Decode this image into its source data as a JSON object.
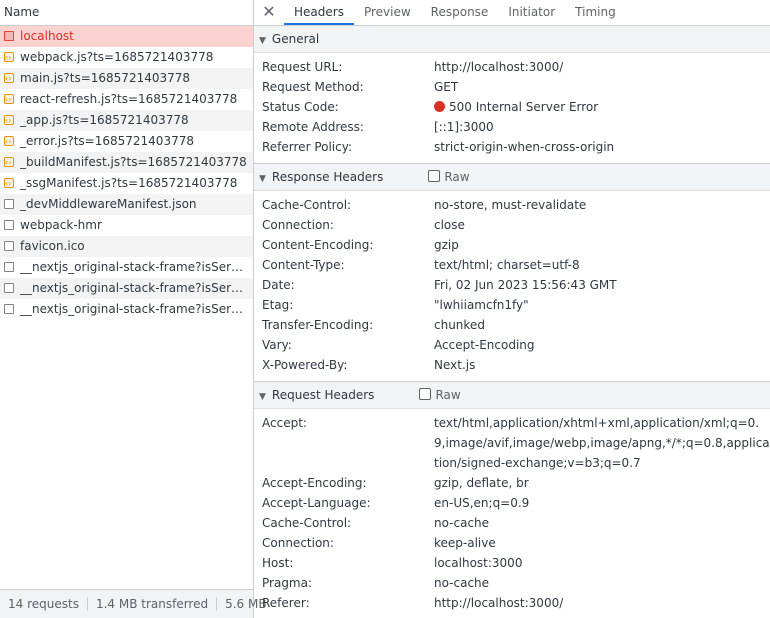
{
  "network": {
    "column_header": "Name",
    "requests": [
      {
        "name": "localhost",
        "icon": "document-icon",
        "selected": true
      },
      {
        "name": "webpack.js?ts=1685721403778",
        "icon": "script-icon"
      },
      {
        "name": "main.js?ts=1685721403778",
        "icon": "script-icon"
      },
      {
        "name": "react-refresh.js?ts=1685721403778",
        "icon": "script-icon"
      },
      {
        "name": "_app.js?ts=1685721403778",
        "icon": "script-icon"
      },
      {
        "name": "_error.js?ts=1685721403778",
        "icon": "script-icon"
      },
      {
        "name": "_buildManifest.js?ts=1685721403778",
        "icon": "script-icon"
      },
      {
        "name": "_ssgManifest.js?ts=1685721403778",
        "icon": "script-icon"
      },
      {
        "name": "_devMiddlewareManifest.json",
        "icon": "document-icon"
      },
      {
        "name": "webpack-hmr",
        "icon": "document-icon"
      },
      {
        "name": "favicon.ico",
        "icon": "document-icon"
      },
      {
        "name": "__nextjs_original-stack-frame?isServer=...",
        "icon": "document-icon"
      },
      {
        "name": "__nextjs_original-stack-frame?isServer=...",
        "icon": "document-icon"
      },
      {
        "name": "__nextjs_original-stack-frame?isServer=...",
        "icon": "document-icon"
      }
    ],
    "status": {
      "requests": "14 requests",
      "transferred": "1.4 MB transferred",
      "resources": "5.6 MB"
    }
  },
  "details": {
    "close": "✕",
    "tabs": [
      "Headers",
      "Preview",
      "Response",
      "Initiator",
      "Timing"
    ],
    "active_tab": "Headers",
    "general": {
      "title": "General",
      "rows": [
        {
          "key": "Request URL:",
          "value": "http://localhost:3000/"
        },
        {
          "key": "Request Method:",
          "value": "GET"
        },
        {
          "key": "Status Code:",
          "value": "500 Internal Server Error",
          "status_dot": "#d93025"
        },
        {
          "key": "Remote Address:",
          "value": "[::1]:3000"
        },
        {
          "key": "Referrer Policy:",
          "value": "strict-origin-when-cross-origin"
        }
      ]
    },
    "response_headers": {
      "title": "Response Headers",
      "raw_label": "Raw",
      "rows": [
        {
          "key": "Cache-Control:",
          "value": "no-store, must-revalidate"
        },
        {
          "key": "Connection:",
          "value": "close"
        },
        {
          "key": "Content-Encoding:",
          "value": "gzip"
        },
        {
          "key": "Content-Type:",
          "value": "text/html; charset=utf-8"
        },
        {
          "key": "Date:",
          "value": "Fri, 02 Jun 2023 15:56:43 GMT"
        },
        {
          "key": "Etag:",
          "value": "\"lwhiiamcfn1fy\""
        },
        {
          "key": "Transfer-Encoding:",
          "value": "chunked"
        },
        {
          "key": "Vary:",
          "value": "Accept-Encoding"
        },
        {
          "key": "X-Powered-By:",
          "value": "Next.js"
        }
      ]
    },
    "request_headers": {
      "title": "Request Headers",
      "raw_label": "Raw",
      "rows": [
        {
          "key": "Accept:",
          "value": "text/html,application/xhtml+xml,application/xml;q=0.9,image/avif,image/webp,image/apng,*/*;q=0.8,application/signed-exchange;v=b3;q=0.7"
        },
        {
          "key": "Accept-Encoding:",
          "value": "gzip, deflate, br"
        },
        {
          "key": "Accept-Language:",
          "value": "en-US,en;q=0.9"
        },
        {
          "key": "Cache-Control:",
          "value": "no-cache"
        },
        {
          "key": "Connection:",
          "value": "keep-alive"
        },
        {
          "key": "Host:",
          "value": "localhost:3000"
        },
        {
          "key": "Pragma:",
          "value": "no-cache"
        },
        {
          "key": "Referer:",
          "value": "http://localhost:3000/"
        }
      ]
    }
  }
}
